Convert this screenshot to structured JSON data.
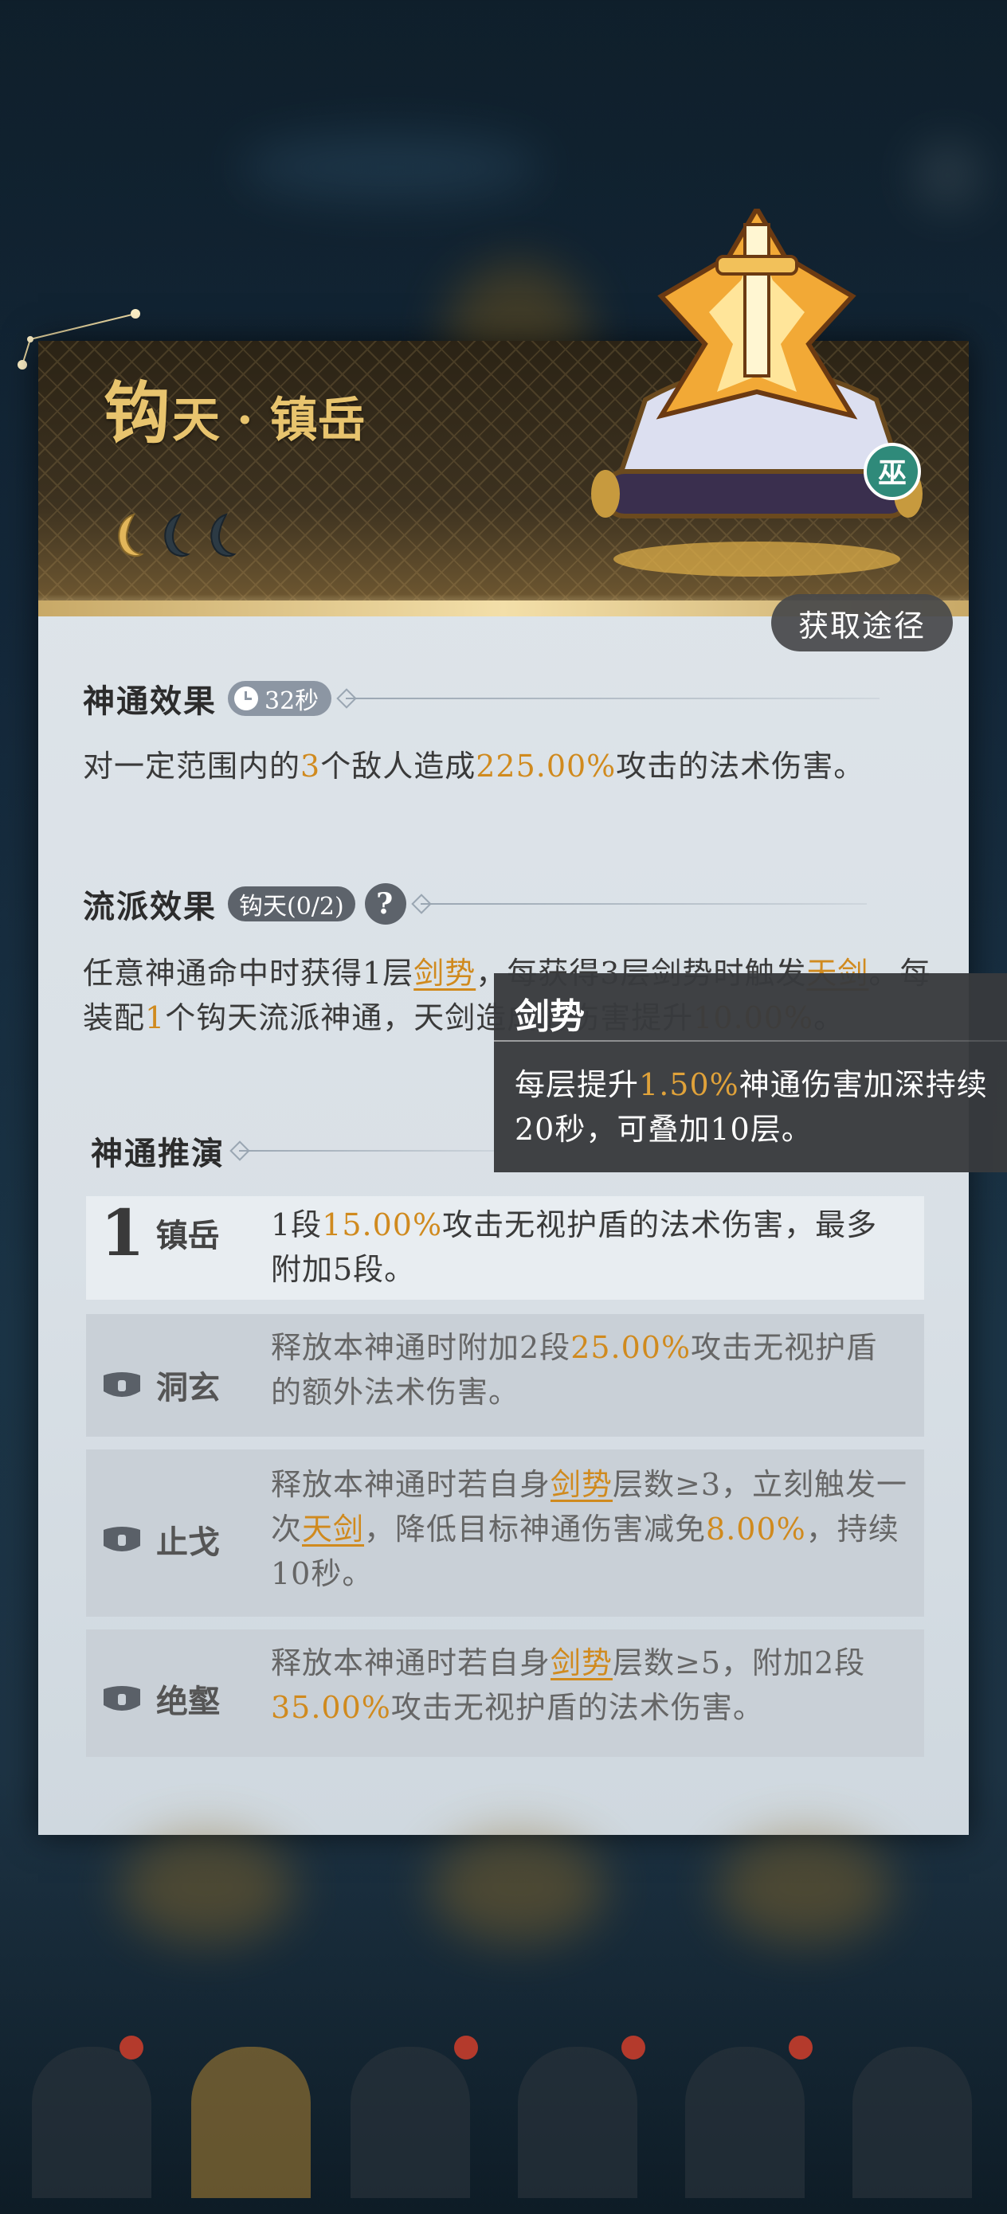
{
  "skill": {
    "title_first": "钩",
    "title_rest": "天 · 镇岳",
    "badge": "巫",
    "acquire_label": "获取途径",
    "moons_filled": 1,
    "moons_total": 3
  },
  "effect": {
    "heading": "神通效果",
    "cooldown": "32秒",
    "text": [
      {
        "t": "对一定范围内的"
      },
      {
        "t": "3",
        "hl": true
      },
      {
        "t": "个敌人造成"
      },
      {
        "t": "225.00%",
        "hl": true
      },
      {
        "t": "攻击的法术伤害。"
      }
    ]
  },
  "school": {
    "heading": "流派效果",
    "tag": "钩天(0/2)",
    "help": "?",
    "text": [
      {
        "t": "任意神通命中时获得1层"
      },
      {
        "t": "剑势",
        "kw": true
      },
      {
        "t": "，每获得3层剑势时触发"
      },
      {
        "t": "天剑",
        "kw": true
      },
      {
        "t": "。每装配"
      },
      {
        "t": "1",
        "hl": true
      },
      {
        "t": "个钩天流派神通，天剑造成的伤害提升"
      },
      {
        "t": "10.00%",
        "hl": true
      },
      {
        "t": "。"
      }
    ]
  },
  "evolution": {
    "heading": "神通推演",
    "rows": [
      {
        "num": "1",
        "name": "镇岳",
        "locked": false,
        "text": [
          {
            "t": "1段"
          },
          {
            "t": "15.00%",
            "hl": true
          },
          {
            "t": "攻击无视护盾的法术伤害，最多附加5段。"
          }
        ]
      },
      {
        "num": "",
        "name": "洞玄",
        "locked": true,
        "text": [
          {
            "t": "释放本神通时附加2段"
          },
          {
            "t": "25.00%",
            "hl": true
          },
          {
            "t": "攻击无视护盾的额外法术伤害。"
          }
        ]
      },
      {
        "num": "",
        "name": "止戈",
        "locked": true,
        "text": [
          {
            "t": "释放本神通时若自身"
          },
          {
            "t": "剑势",
            "kw": true
          },
          {
            "t": "层数≥3，立刻触发一次"
          },
          {
            "t": "天剑",
            "kw": true
          },
          {
            "t": "，降低目标神通伤害减免"
          },
          {
            "t": "8.00%",
            "hl": true
          },
          {
            "t": "，持续10秒。"
          }
        ]
      },
      {
        "num": "",
        "name": "绝壑",
        "locked": true,
        "text": [
          {
            "t": "释放本神通时若自身"
          },
          {
            "t": "剑势",
            "kw": true
          },
          {
            "t": "层数≥5，附加2段"
          },
          {
            "t": "35.00%",
            "hl": true
          },
          {
            "t": "攻击无视护盾的法术伤害。"
          }
        ]
      }
    ]
  },
  "tooltip": {
    "title": "剑势",
    "text": [
      {
        "t": "每层提升"
      },
      {
        "t": "1.50%",
        "hl": true
      },
      {
        "t": "神通伤害加深持续20秒，可叠加10层。"
      }
    ]
  },
  "colors": {
    "gold": "#e8c46e",
    "highlight": "#d08a1e",
    "card": "#dfe5ea",
    "tooltip": "#383a3d"
  }
}
